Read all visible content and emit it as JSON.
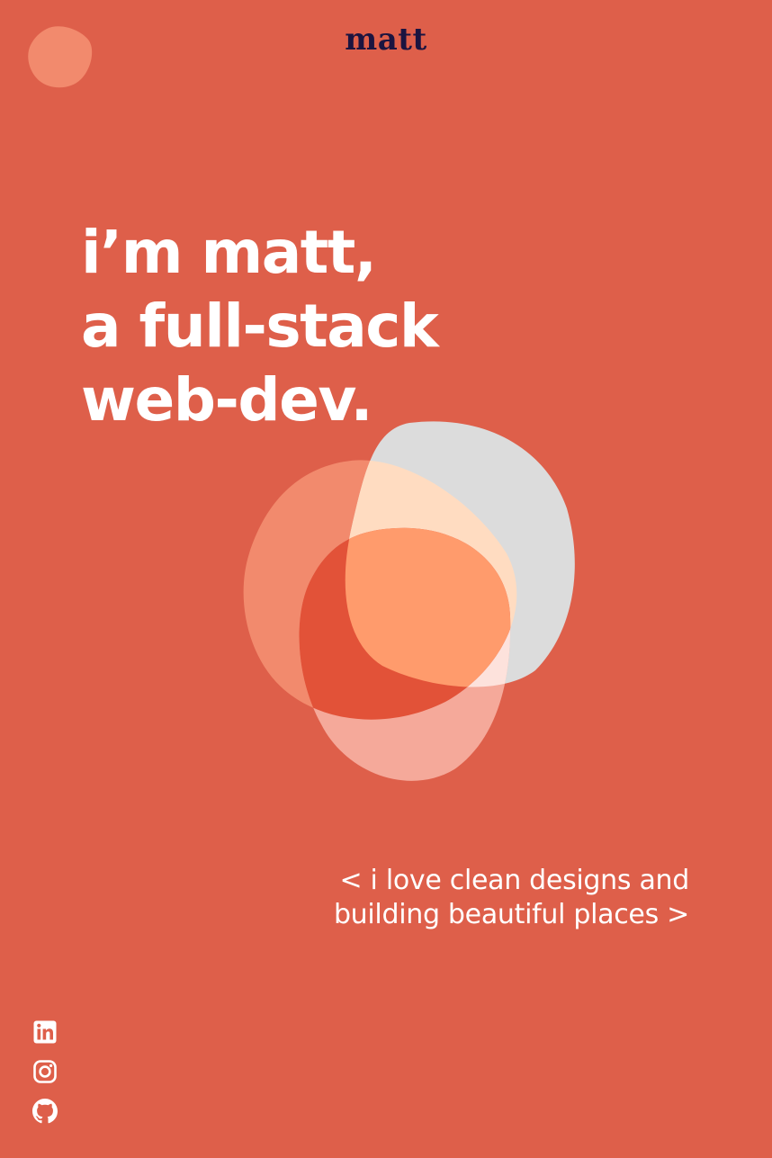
{
  "header": {
    "logo_text": "matt"
  },
  "hero": {
    "line1": "i’m matt,",
    "line2": "a full-stack",
    "line3": "web-dev."
  },
  "tagline": {
    "line1": "< i love clean designs and",
    "line2": "building beautiful places >"
  },
  "social": [
    {
      "name": "LinkedIn",
      "icon": "linkedin-icon"
    },
    {
      "name": "Instagram",
      "icon": "instagram-icon"
    },
    {
      "name": "GitHub",
      "icon": "github-icon"
    }
  ],
  "colors": {
    "background": "#de5f4a",
    "logo": "#1b1440",
    "text": "#ffffff",
    "blob_salmon": "#f28a6d",
    "blob_gray": "#dcdcdc",
    "blob_pink": "#f5a99a",
    "blob_red": "#e25238",
    "blob_orange": "#ff9b6c",
    "blob_cream": "#ffdcc1"
  }
}
